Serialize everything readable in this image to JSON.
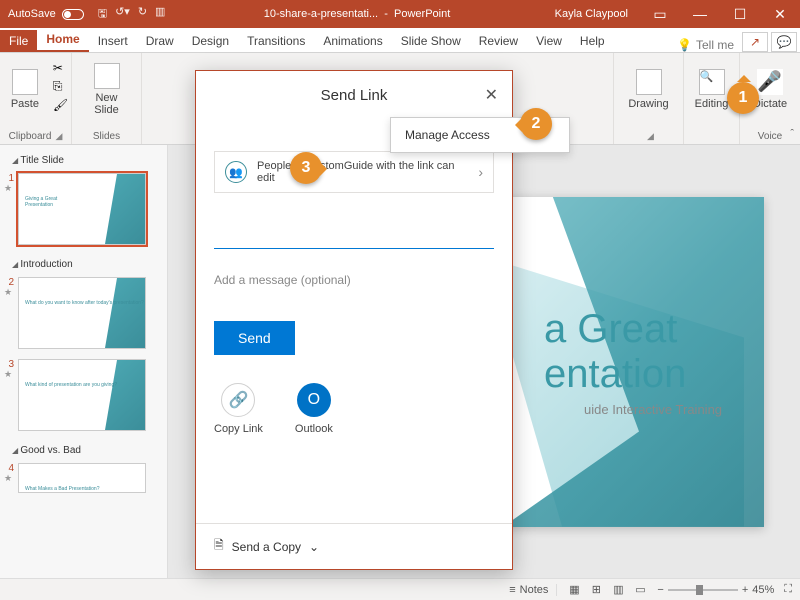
{
  "titlebar": {
    "autosave": "AutoSave",
    "doc": "10-share-a-presentati...",
    "app": "PowerPoint",
    "user": "Kayla Claypool"
  },
  "menu": {
    "file": "File",
    "home": "Home",
    "insert": "Insert",
    "draw": "Draw",
    "design": "Design",
    "transitions": "Transitions",
    "animations": "Animations",
    "slideshow": "Slide Show",
    "review": "Review",
    "view": "View",
    "help": "Help",
    "tellme": "Tell me"
  },
  "ribbon": {
    "paste": "Paste",
    "clipboard": "Clipboard",
    "newslide": "New\nSlide",
    "slides": "Slides",
    "drawing": "Drawing",
    "editing": "Editing",
    "dictate": "Dictate",
    "voice": "Voice"
  },
  "sections": {
    "s1": "Title Slide",
    "s2": "Introduction",
    "s3": "Good vs. Bad"
  },
  "thumbs": {
    "t1_title": "Giving a Great\nPresentation",
    "t2": "What do you want to know after today's presentation?",
    "t3": "What kind of presentation are you giving?",
    "t4": "What Makes a Bad Presentation?"
  },
  "slide": {
    "title_vis": "a Great\nentation",
    "sub_vis": "uide Interactive Training"
  },
  "share": {
    "title": "Send Link",
    "manage": "Manage Access",
    "perm": "People in CustomGuide with the link can edit",
    "msg": "Add a message (optional)",
    "send": "Send",
    "copylink": "Copy Link",
    "outlook": "Outlook",
    "sendcopy": "Send a Copy"
  },
  "status": {
    "notes": "Notes",
    "zoom": "45%"
  },
  "callouts": {
    "c1": "1",
    "c2": "2",
    "c3": "3"
  }
}
